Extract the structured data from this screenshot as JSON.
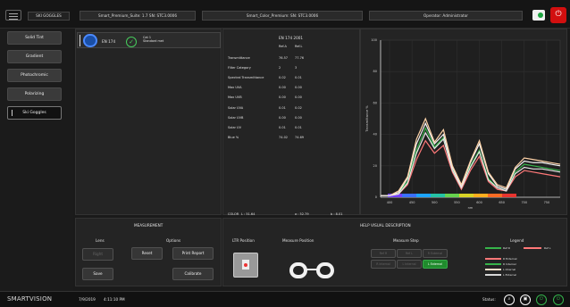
{
  "header": {
    "brand_tab": "SKI GOGGLES",
    "fields": [
      "Smart_Premium_Suite: 1.7 SN: STC3.0006",
      "Smart_Color_Premium: SN: STC3.0006",
      "Operator: Administrator"
    ]
  },
  "sidebar": {
    "items": [
      "Solid Tint",
      "Gradient",
      "Photochromic",
      "Polarizing",
      "Ski Goggles"
    ],
    "active_index": 4
  },
  "lens_card": {
    "standard": "EN 174",
    "cat": "Cat 1",
    "status": "Standard met"
  },
  "results": {
    "title": "EN 174 2001",
    "headers": [
      "",
      "Ref.A",
      "Ref.L"
    ],
    "rows": [
      [
        "Transmittance",
        "76.57",
        "77.76"
      ],
      [
        "Filter Category",
        "2",
        "3"
      ],
      [
        "Spectral Transmittance",
        "0.02",
        "0.01"
      ],
      [
        "Max UVA",
        "0.00",
        "0.00"
      ],
      [
        "Max UVB",
        "0.00",
        "0.00"
      ],
      [
        "Solar UVA",
        "0.01",
        "0.02"
      ],
      [
        "Solar UVB",
        "0.00",
        "0.00"
      ],
      [
        "Solar UV",
        "0.01",
        "0.01"
      ],
      [
        "Blue %",
        "74.02",
        "74.69"
      ]
    ],
    "color_label": "COLOR",
    "color_L": "L : 51.64",
    "color_a": "a : 52.79",
    "color_b": "b : 8.01"
  },
  "chart_data": {
    "type": "line",
    "title": "",
    "xlabel": "nm",
    "ylabel": "Transmittance %",
    "x": [
      380,
      400,
      420,
      440,
      460,
      480,
      500,
      520,
      540,
      560,
      580,
      600,
      620,
      640,
      660,
      680,
      700,
      720,
      740,
      760,
      780
    ],
    "xlim": [
      380,
      780
    ],
    "ylim": [
      0,
      100
    ],
    "xticks": [
      400,
      450,
      500,
      550,
      600,
      650,
      700,
      750
    ],
    "yticks": [
      0,
      20,
      40,
      60,
      80,
      100
    ],
    "grid": true,
    "series": [
      {
        "name": "Ref R",
        "color": "#36b44a",
        "values": [
          1,
          1,
          3,
          10,
          30,
          44,
          32,
          38,
          18,
          6,
          20,
          30,
          12,
          6,
          4,
          16,
          21,
          20,
          19,
          18,
          17
        ]
      },
      {
        "name": "R External",
        "color": "#ff7878",
        "values": [
          1,
          1,
          2,
          8,
          24,
          36,
          28,
          33,
          16,
          5,
          17,
          26,
          10,
          5,
          4,
          13,
          17,
          16,
          15,
          14,
          13
        ]
      },
      {
        "name": "R Internal",
        "color": "#f4f4f4",
        "values": [
          1,
          1,
          3,
          12,
          34,
          47,
          34,
          40,
          19,
          7,
          22,
          34,
          15,
          7,
          5,
          18,
          23,
          22,
          22,
          21,
          20
        ]
      },
      {
        "name": "L Internal",
        "color": "#ffd3a8",
        "values": [
          1,
          1,
          4,
          13,
          37,
          50,
          35,
          43,
          20,
          8,
          23,
          36,
          16,
          8,
          6,
          19,
          25,
          24,
          23,
          22,
          21
        ]
      },
      {
        "name": "L External",
        "color": "#e5e5e5",
        "values": [
          1,
          1,
          2,
          9,
          28,
          41,
          31,
          37,
          17,
          6,
          19,
          29,
          11,
          6,
          4,
          15,
          19,
          18,
          18,
          17,
          16
        ]
      }
    ]
  },
  "measurement": {
    "title": "MEASUREMENT",
    "lens_label": "Lens",
    "options_label": "Options",
    "buttons": [
      "Right",
      "Reset",
      "Print Report",
      "Save",
      "Calibrate"
    ]
  },
  "help": {
    "title": "HELP VISUAL DESCRIPTION",
    "ltr_position": "LTR Position",
    "measure_position": "Measure Position",
    "measure_step": "Measure Step",
    "steps": [
      "Ref R",
      "Ref L",
      "R External",
      "R Internal",
      "L Internal",
      "L External"
    ],
    "legend_title": "Legend",
    "legend": [
      {
        "label": "Ref R",
        "color": "#36b44a"
      },
      {
        "label": "Ref L",
        "color": "#ff7878"
      },
      {
        "label": "R External",
        "color": "#ff7878"
      },
      {
        "label": "R Internal",
        "color": "#36b44a"
      },
      {
        "label": "L Internal",
        "color": "#f1ddc6"
      },
      {
        "label": "L External",
        "color": "#d8d8d8"
      }
    ]
  },
  "footer": {
    "logo": "SMARTVISION",
    "date": "7/9/2019",
    "time": "4:11:10 PM",
    "status_label": "Status:",
    "status_icons": [
      "compass-icon",
      "printer-icon",
      "power-icon",
      "power-icon"
    ]
  },
  "colors": {
    "bg": "#1a1a1a",
    "panel": "#242424",
    "green": "#208b2d",
    "red": "#d02020"
  }
}
